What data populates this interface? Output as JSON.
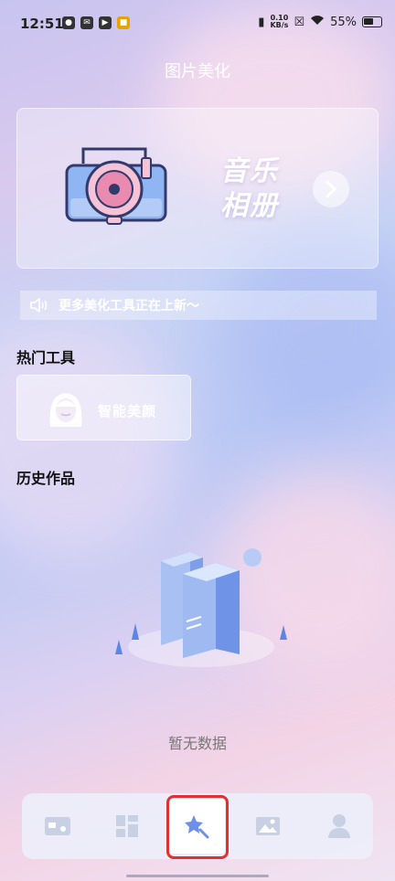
{
  "status_bar": {
    "time": "12:51",
    "speed_top": "0.10",
    "speed_bottom": "KB/s",
    "battery_text": "55%"
  },
  "page_title": "图片美化",
  "banner": {
    "line1": "音乐",
    "line2": "相册"
  },
  "notice": {
    "text": "更多美化工具正在上新～"
  },
  "hot_tools": {
    "title": "热门工具",
    "items": [
      {
        "label": "智能美颜",
        "icon": "face-avatar-icon"
      }
    ]
  },
  "history": {
    "title": "历史作品",
    "empty_text": "暂无数据"
  },
  "bottom_nav": {
    "items": [
      {
        "icon": "id-card-icon"
      },
      {
        "icon": "grid-layout-icon"
      },
      {
        "icon": "magic-star-icon",
        "active": true
      },
      {
        "icon": "image-icon"
      },
      {
        "icon": "user-icon"
      }
    ]
  },
  "colors": {
    "highlight": "#e03030",
    "nav_icon": "#c8d0e3",
    "active_icon": "#6e8fe8"
  }
}
